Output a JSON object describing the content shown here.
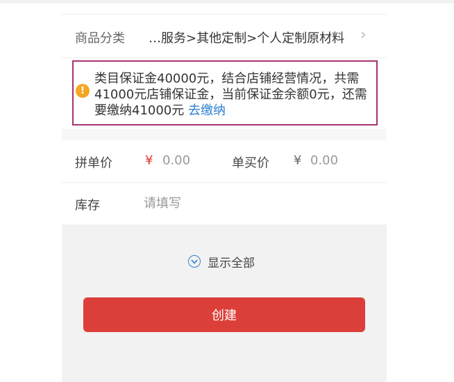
{
  "category": {
    "label": "商品分类",
    "value": "…服务>其他定制>个人定制原材料",
    "chevron": "›"
  },
  "notice": {
    "icon": "warning-icon",
    "icon_glyph": "!",
    "text": "类目保证金40000元，结合店铺经营情况，共需41000元店铺保证金，当前保证金余额0元，还需要缴纳41000元 ",
    "link_label": "去缴纳"
  },
  "price": {
    "group_label": "拼单价",
    "group_currency": "¥",
    "group_value": "0.00",
    "single_label": "单买价",
    "single_currency": "¥",
    "single_value": "0.00"
  },
  "stock": {
    "label": "库存",
    "placeholder": "请填写"
  },
  "show_all": {
    "icon": "chevron-down-circle-icon",
    "label": "显示全部"
  },
  "create_button": {
    "label": "创建"
  },
  "colors": {
    "accent_red": "#dc3f39",
    "link_blue": "#2c7fd0",
    "warning_orange": "#f5a623",
    "highlight_border": "#a8326f"
  }
}
